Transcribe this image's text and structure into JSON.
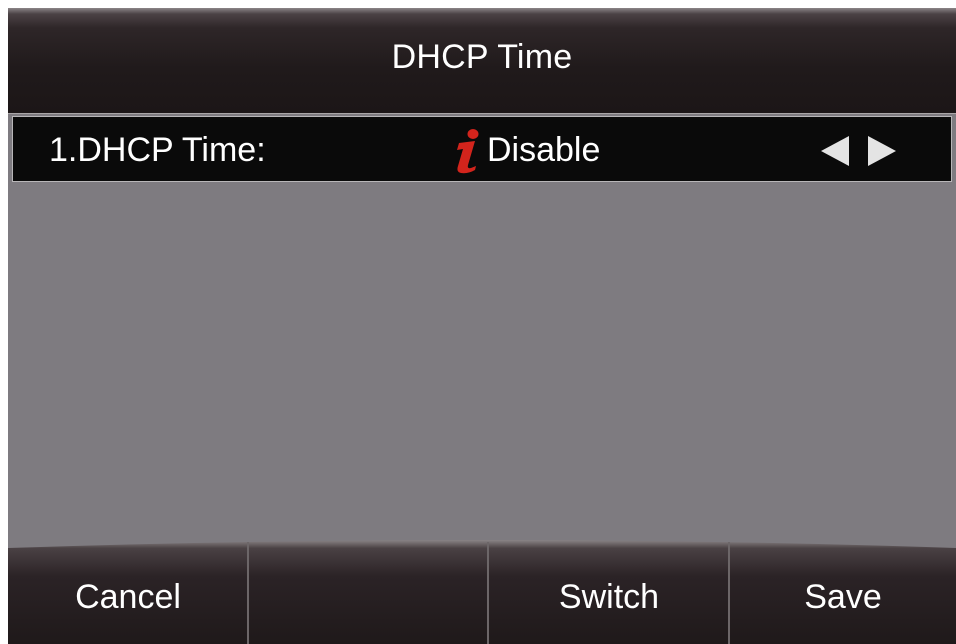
{
  "title": "DHCP Time",
  "row": {
    "label": "1.DHCP Time:",
    "value": "Disable",
    "info_icon": "info-icon",
    "left_arrow_icon": "arrow-left-icon",
    "right_arrow_icon": "arrow-right-icon"
  },
  "softkeys": [
    "Cancel",
    "",
    "Switch",
    "Save"
  ],
  "colors": {
    "screen_bg": "#7e7b80",
    "bar_dark": "#1c1617",
    "row_selected_bg": "#0a0a0a",
    "info_icon_red": "#d3241c",
    "text": "#ffffff"
  }
}
